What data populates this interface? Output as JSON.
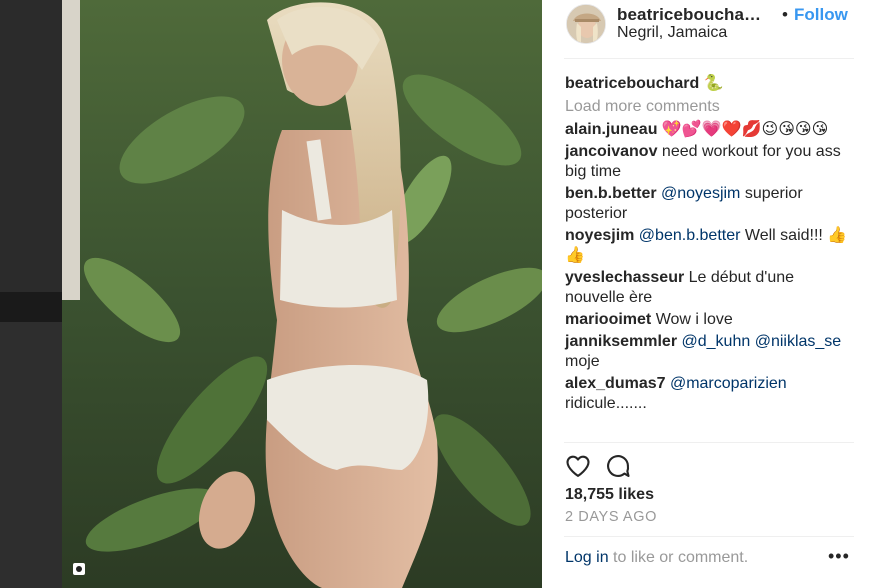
{
  "post": {
    "username": "beatricebouchard",
    "username_truncated": "beatricebouchа…",
    "follow_label": "Follow",
    "separator": "•",
    "location": "Negril, Jamaica",
    "caption_emoji": "🐍",
    "load_more": "Load more comments",
    "likes": "18,755 likes",
    "time_ago": "2 DAYS AGO",
    "login_link": "Log in",
    "login_suffix": " to like or comment.",
    "more_label": "•••"
  },
  "comments": [
    {
      "user": "alain.juneau",
      "parts": [
        {
          "t": "text",
          "v": " 💖💕💗❤️💋😉😘😘😘"
        }
      ]
    },
    {
      "user": "jancoivanov",
      "parts": [
        {
          "t": "text",
          "v": " need workout for you ass big time"
        }
      ]
    },
    {
      "user": "ben.b.better",
      "parts": [
        {
          "t": "mention",
          "v": " @noyesjim"
        },
        {
          "t": "text",
          "v": " superior posterior"
        }
      ]
    },
    {
      "user": "noyesjim",
      "parts": [
        {
          "t": "mention",
          "v": " @ben.b.better"
        },
        {
          "t": "text",
          "v": " Well said!!! 👍👍"
        }
      ]
    },
    {
      "user": "yveslechasseur",
      "parts": [
        {
          "t": "text",
          "v": " Le début d'une nouvelle ère"
        }
      ]
    },
    {
      "user": "mariooimet",
      "parts": [
        {
          "t": "text",
          "v": " Wow i love"
        }
      ]
    },
    {
      "user": "janniksemmler",
      "parts": [
        {
          "t": "mention",
          "v": " @d_kuhn"
        },
        {
          "t": "mention",
          "v": " @niiklas_se"
        },
        {
          "t": "text",
          "v": " moje"
        }
      ]
    },
    {
      "user": "alex_dumas7",
      "parts": [
        {
          "t": "mention",
          "v": " @marcoparizien"
        },
        {
          "t": "text",
          "v": " ridicule......."
        }
      ]
    }
  ],
  "icons": {
    "heart": "heart-icon",
    "comment": "comment-icon",
    "more": "more-options-icon",
    "multi": "carousel-icon"
  },
  "colors": {
    "link_blue": "#3897f0",
    "mention_blue": "#003569",
    "muted_gray": "#999999",
    "text": "#262626"
  }
}
